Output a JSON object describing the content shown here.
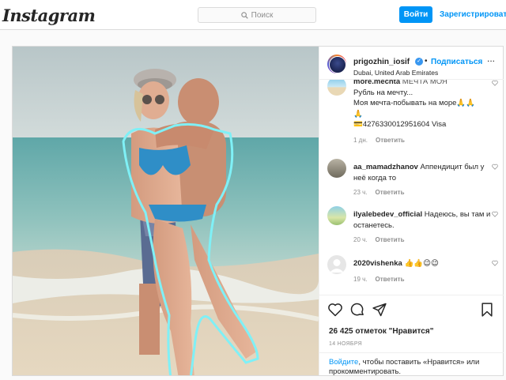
{
  "header": {
    "logo": "Instagram",
    "search_placeholder": "Поиск",
    "login_label": "Войти",
    "register_label": "Зарегистрироваться"
  },
  "post": {
    "username": "prigozhin_iosif",
    "verified_icon": "verified-badge-icon",
    "dot": "•",
    "follow_label": "Подписаться",
    "location": "Dubai, United Arab Emirates",
    "more_label": "...",
    "likes": "26 425 отметок \"Нравится\"",
    "date": "14 НОЯБРЯ",
    "prompt_link": "Войдите",
    "prompt_rest": ", чтобы поставить «Нравится» или прокомментировать."
  },
  "comments": [
    {
      "user": "more.mechta",
      "lines": [
        "МЕЧТА МОЯ",
        "Рубль на мечту...",
        "Моя мечта-побывать на море🙏🙏",
        "🙏",
        "💳4276330012951604 Visa"
      ],
      "time": "1 дн.",
      "reply": "Ответить"
    },
    {
      "user": "aa_mamadzhanov",
      "text": "Аппендицит был у неё когда то",
      "time": "23 ч.",
      "reply": "Ответить"
    },
    {
      "user": "ilyalebedev_official",
      "text": "Надеюсь, вы там и останетесь.",
      "time": "20 ч.",
      "reply": "Ответить"
    },
    {
      "user": "2020vishenka",
      "text": "👍👍😉😉",
      "time": "19 ч.",
      "reply": "Ответить"
    }
  ],
  "colors": {
    "accent": "#0095f6",
    "outline": "#7ff0f6"
  }
}
